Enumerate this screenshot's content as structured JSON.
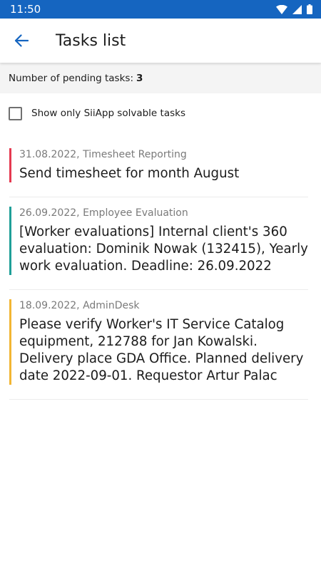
{
  "status": {
    "time": "11:50",
    "bar_color": "#1565c0"
  },
  "header": {
    "back_icon": "arrow-left-icon",
    "title": "Tasks list"
  },
  "pending": {
    "label": "Number of pending tasks:",
    "count": "3"
  },
  "filter": {
    "label": "Show only SiiApp solvable tasks",
    "checked": false
  },
  "tasks": [
    {
      "date": "31.08.2022",
      "category": "Timesheet Reporting",
      "text": "Send timesheet for month August",
      "color": "#e53950"
    },
    {
      "date": "26.09.2022",
      "category": "Employee Evaluation",
      "text": "[Worker evaluations] Internal client's 360 evaluation: Dominik Nowak (132415), Yearly work evaluation. Deadline: 26.09.2022",
      "color": "#1f9f98"
    },
    {
      "date": "18.09.2022",
      "category": "AdminDesk",
      "text": "Please verify Worker's IT Service Catalog equipment, 212788 for Jan Kowalski. Delivery place GDA Office. Planned delivery date 2022-09-01. Requestor Artur Palac",
      "color": "#f2b533"
    }
  ]
}
